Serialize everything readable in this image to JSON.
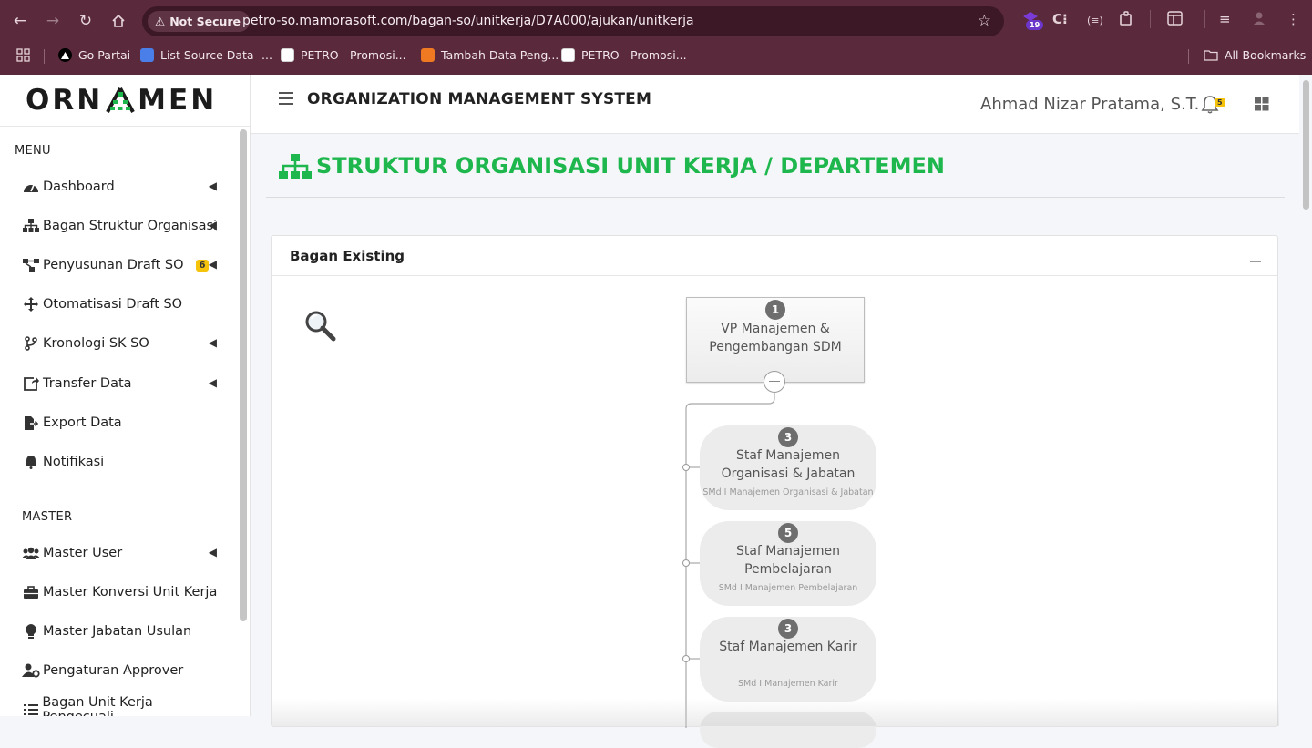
{
  "browser": {
    "security_label": "Not Secure",
    "url": "petro-so.mamorasoft.com/bagan-so/unitkerja/D7A000/ajukan/unitkerja",
    "extension_badge": "19",
    "bookmarks": [
      {
        "label": "Go Partai"
      },
      {
        "label": "List Source Data -..."
      },
      {
        "label": "PETRO - Promosi..."
      },
      {
        "label": "Tambah Data Peng..."
      },
      {
        "label": "PETRO - Promosi..."
      }
    ],
    "all_bookmarks": "All Bookmarks"
  },
  "sidebar": {
    "logo_left": "ORN",
    "logo_right": "MEN",
    "menu_heading": "MENU",
    "menu_items": [
      {
        "label": "Dashboard"
      },
      {
        "label": "Bagan Struktur Organisasi"
      },
      {
        "label": "Penyusunan Draft SO",
        "badge": "6"
      },
      {
        "label": "Otomatisasi Draft SO"
      },
      {
        "label": "Kronologi SK SO"
      },
      {
        "label": "Transfer Data"
      },
      {
        "label": "Export Data"
      },
      {
        "label": "Notifikasi"
      }
    ],
    "master_heading": "MASTER",
    "master_items": [
      {
        "label": "Master User"
      },
      {
        "label": "Master Konversi Unit Kerja"
      },
      {
        "label": "Master Jabatan Usulan"
      },
      {
        "label": "Pengaturan Approver"
      },
      {
        "label": "Bagan Unit Kerja Pengecuali"
      }
    ]
  },
  "header": {
    "system_title": "ORGANIZATION MANAGEMENT SYSTEM",
    "user_name": "Ahmad Nizar Pratama, S.T.",
    "notification_count": "5"
  },
  "page": {
    "title": "STRUKTUR ORGANISASI UNIT KERJA / DEPARTEMEN",
    "accent_color": "#1eb74d"
  },
  "card": {
    "title": "Bagan Existing",
    "root": {
      "count": "1",
      "name": "VP Manajemen & Pengembangan SDM"
    },
    "children": [
      {
        "count": "3",
        "name": "Staf Manajemen Organisasi & Jabatan",
        "sub": "SMd I Manajemen Organisasi & Jabatan"
      },
      {
        "count": "5",
        "name": "Staf Manajemen Pembelajaran",
        "sub": "SMd I Manajemen Pembelajaran"
      },
      {
        "count": "3",
        "name": "Staf Manajemen Karir",
        "sub": "SMd I Manajemen Karir"
      }
    ]
  }
}
